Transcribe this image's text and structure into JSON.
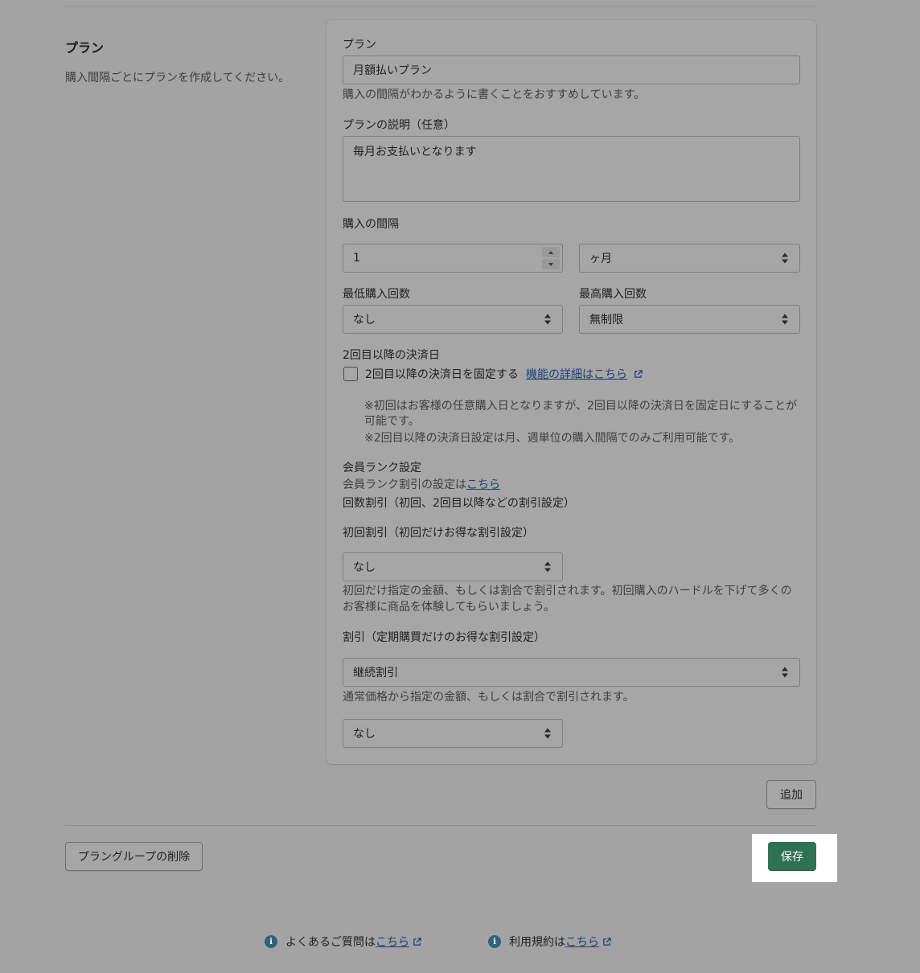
{
  "section": {
    "title": "プラン",
    "description": "購入間隔ごとにプランを作成してください。"
  },
  "plan": {
    "name_label": "プラン",
    "name_value": "月額払いプラン",
    "name_help": "購入の間隔がわかるように書くことをおすすめしています。",
    "desc_label": "プランの説明（任意）",
    "desc_value": "毎月お支払いとなります",
    "interval_label": "購入の間隔",
    "interval_value": "1",
    "interval_unit": "ヶ月",
    "min_label": "最低購入回数",
    "min_value": "なし",
    "max_label": "最高購入回数",
    "max_value": "無制限",
    "billing_label": "2回目以降の決済日",
    "billing_checkbox_label": "2回目以降の決済日を固定する",
    "billing_link": "機能の詳細はこちら",
    "billing_note_1": "※初回はお客様の任意購入日となりますが、2回目以降の決済日を固定日にすることが",
    "billing_note_1b": "可能です。",
    "billing_note_2": "※2回目以降の決済日設定は月、週単位の購入間隔でのみご利用可能です。",
    "rank_label": "会員ランク設定",
    "rank_help_prefix": "会員ランク割引の設定は",
    "rank_help_link": "こちら",
    "count_discount_label": "回数割引（初回、2回目以降などの割引設定）",
    "first_discount_label": "初回割引（初回だけお得な割引設定）",
    "first_discount_value": "なし",
    "first_discount_help_1": "初回だけ指定の金額、もしくは割合で割引されます。初回購入のハードルを下げて多くの",
    "first_discount_help_2": "お客様に商品を体験してもらいましょう。",
    "discount_label": "割引（定期購買だけのお得な割引設定）",
    "discount_type_value": "継続割引",
    "discount_help": "通常価格から指定の金額、もしくは割合で割引されます。",
    "discount_amount_value": "なし"
  },
  "buttons": {
    "add": "追加",
    "delete_group": "プラングループの削除",
    "save": "保存"
  },
  "footer": {
    "faq_prefix": "よくあるご質問は",
    "faq_link": "こちら",
    "terms_prefix": "利用規約は",
    "terms_link": "こちら"
  },
  "icons": {
    "select": "select-arrows-icon",
    "external": "external-link-icon",
    "info": "info-icon"
  }
}
